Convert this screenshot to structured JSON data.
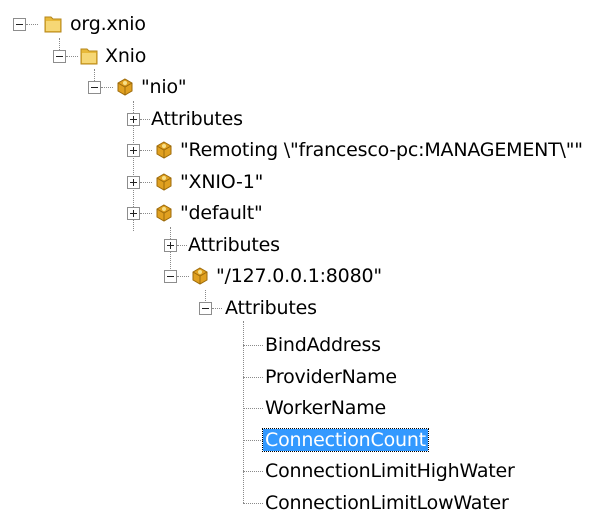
{
  "tree": {
    "root_label": "org.xnio",
    "xnio_label": "Xnio",
    "nio_label": "\"nio\"",
    "nio_attributes_label": "Attributes",
    "remoting_label": "\"Remoting \\\"francesco-pc:MANAGEMENT\\\"\"",
    "xnio1_label": "\"XNIO-1\"",
    "default_label": "\"default\"",
    "default_attributes_label": "Attributes",
    "endpoint_label": "\"/127.0.0.1:8080\"",
    "endpoint_attributes_label": "Attributes",
    "attributes": [
      "BindAddress",
      "ProviderName",
      "WorkerName",
      "ConnectionCount",
      "ConnectionLimitHighWater",
      "ConnectionLimitLowWater"
    ],
    "selected_item": "ConnectionCount"
  },
  "colors": {
    "folder": "#e8b93a",
    "bean": "#e0a020",
    "selection": "#3399ff"
  },
  "icons": {
    "folder": "folder-icon",
    "bean": "mbean-icon"
  }
}
